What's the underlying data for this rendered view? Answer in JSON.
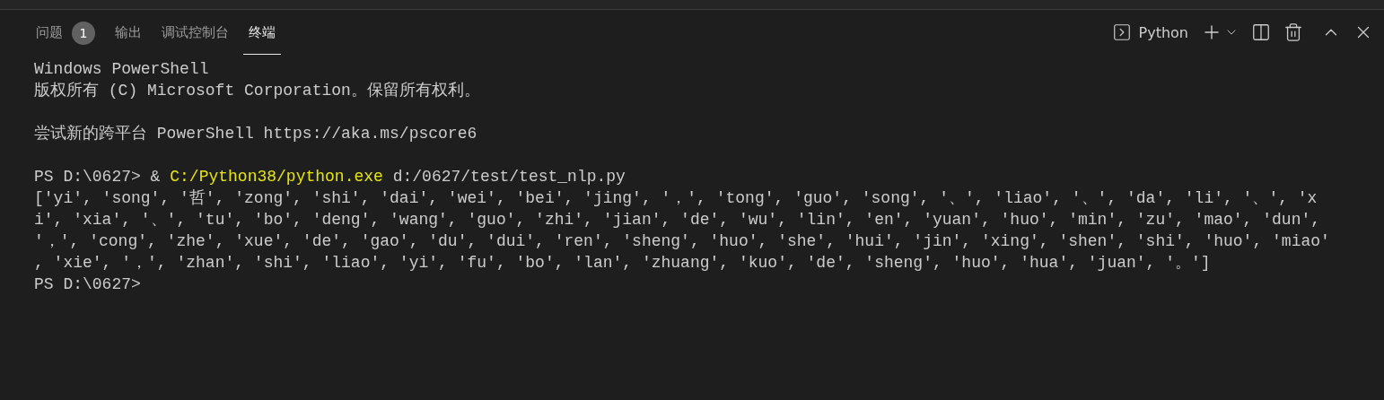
{
  "tabs": [
    {
      "label": "问题",
      "badge": "1",
      "selected": false
    },
    {
      "label": "输出",
      "selected": false
    },
    {
      "label": "调试控制台",
      "selected": false
    },
    {
      "label": "终端",
      "selected": true
    }
  ],
  "toolbar": {
    "shell": "Python"
  },
  "terminal": {
    "lines": [
      {
        "kind": "text",
        "text": "Windows PowerShell"
      },
      {
        "kind": "text",
        "text": "版权所有 (C) Microsoft Corporation。保留所有权利。"
      },
      {
        "kind": "blank"
      },
      {
        "kind": "text",
        "text": "尝试新的跨平台 PowerShell https://aka.ms/pscore6"
      },
      {
        "kind": "blank"
      },
      {
        "kind": "command",
        "prompt": "PS D:\\0627> & ",
        "program": "C:/Python38/python.exe",
        "args": " d:/0627/test/test_nlp.py"
      },
      {
        "kind": "text",
        "text": "['yi', 'song', '哲', 'zong', 'shi', 'dai', 'wei', 'bei', 'jing', '，', 'tong', 'guo', 'song', '、', 'liao', '、', 'da', 'li', '、', 'x"
      },
      {
        "kind": "text",
        "text": "i', 'xia', '、', 'tu', 'bo', 'deng', 'wang', 'guo', 'zhi', 'jian', 'de', 'wu', 'lin', 'en', 'yuan', 'huo', 'min', 'zu', 'mao', 'dun',"
      },
      {
        "kind": "text",
        "text": "'，', 'cong', 'zhe', 'xue', 'de', 'gao', 'du', 'dui', 'ren', 'sheng', 'huo', 'she', 'hui', 'jin', 'xing', 'shen', 'shi', 'huo', 'miao'"
      },
      {
        "kind": "text",
        "text": ", 'xie', '，', 'zhan', 'shi', 'liao', 'yi', 'fu', 'bo', 'lan', 'zhuang', 'kuo', 'de', 'sheng', 'huo', 'hua', 'juan', '。']"
      },
      {
        "kind": "text",
        "text": "PS D:\\0627>"
      }
    ]
  }
}
